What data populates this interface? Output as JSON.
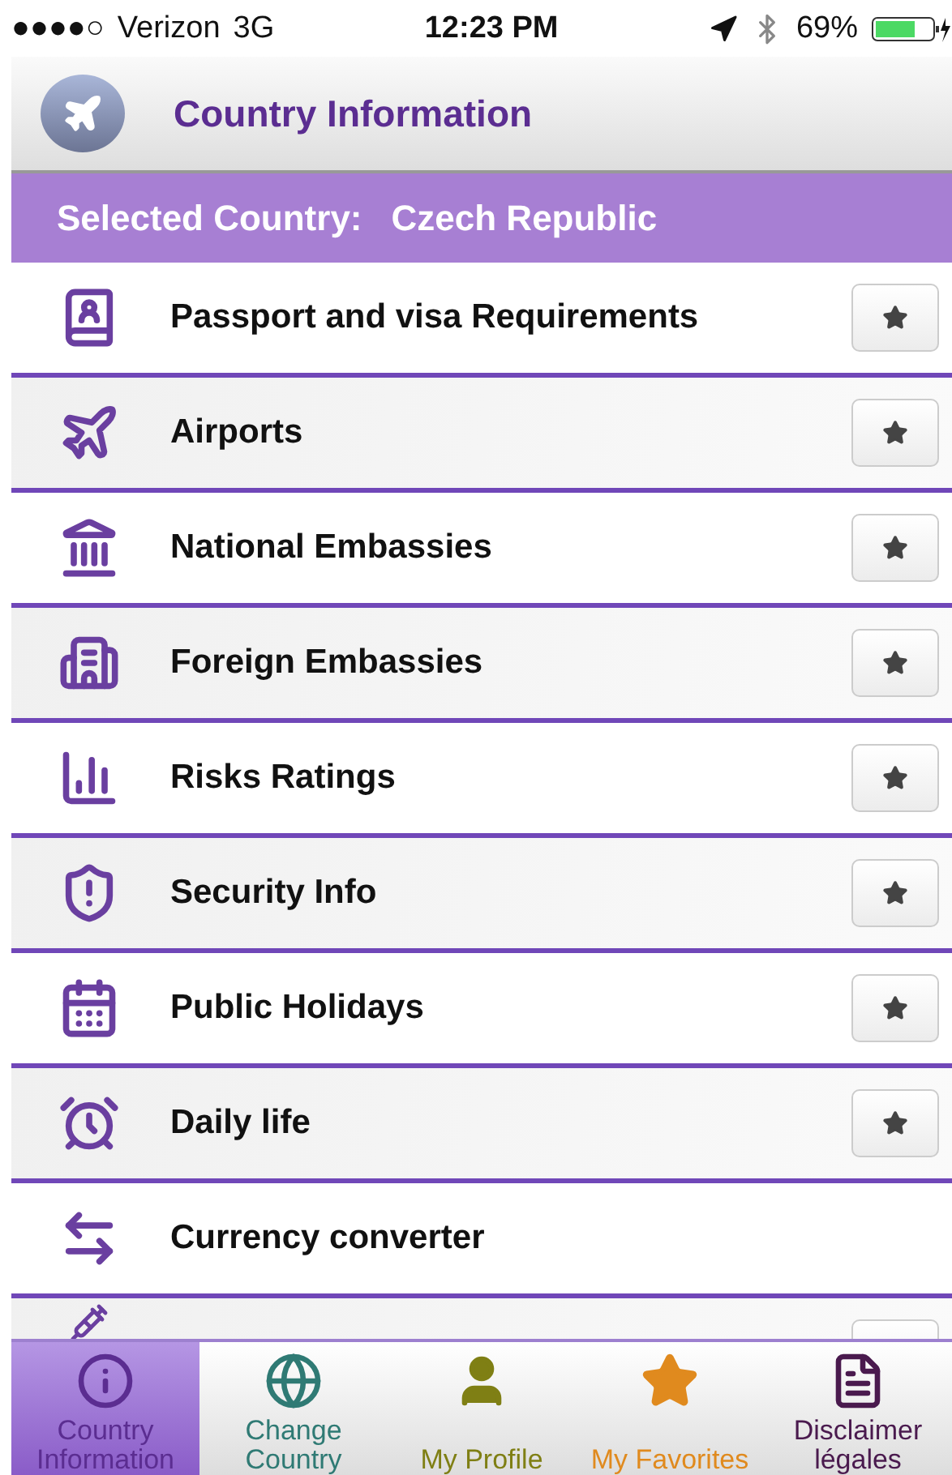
{
  "status_bar": {
    "signal": "●●●●○",
    "carrier": "Verizon",
    "network": "3G",
    "time": "12:23 PM",
    "battery": "69%"
  },
  "header": {
    "title": "Country Information"
  },
  "banner": {
    "label": "Selected Country:",
    "country": "Czech Republic"
  },
  "rows": [
    {
      "label": "Passport and visa Requirements",
      "kind": "favoritable"
    },
    {
      "label": "Airports",
      "kind": "favoritable"
    },
    {
      "label": "National Embassies",
      "kind": "favoritable"
    },
    {
      "label": "Foreign Embassies",
      "kind": "favoritable"
    },
    {
      "label": "Risks Ratings",
      "kind": "favoritable"
    },
    {
      "label": "Security Info",
      "kind": "favoritable"
    },
    {
      "label": "Public Holidays",
      "kind": "favoritable"
    },
    {
      "label": "Daily life",
      "kind": "favoritable"
    },
    {
      "label": "Currency converter",
      "kind": "plain"
    },
    {
      "label": "",
      "kind": "favoritable"
    }
  ],
  "tabs": [
    {
      "label": "Country Information",
      "selected": true,
      "color": "#5b2d91"
    },
    {
      "label": "Change Country",
      "selected": false,
      "color": "#2f7a74"
    },
    {
      "label": "My Profile",
      "selected": false,
      "color": "#7f7f14"
    },
    {
      "label": "My Favorites",
      "selected": false,
      "color": "#e08a1e"
    },
    {
      "label": "Disclaimer légales",
      "selected": false,
      "color": "#4a1a4e"
    }
  ]
}
